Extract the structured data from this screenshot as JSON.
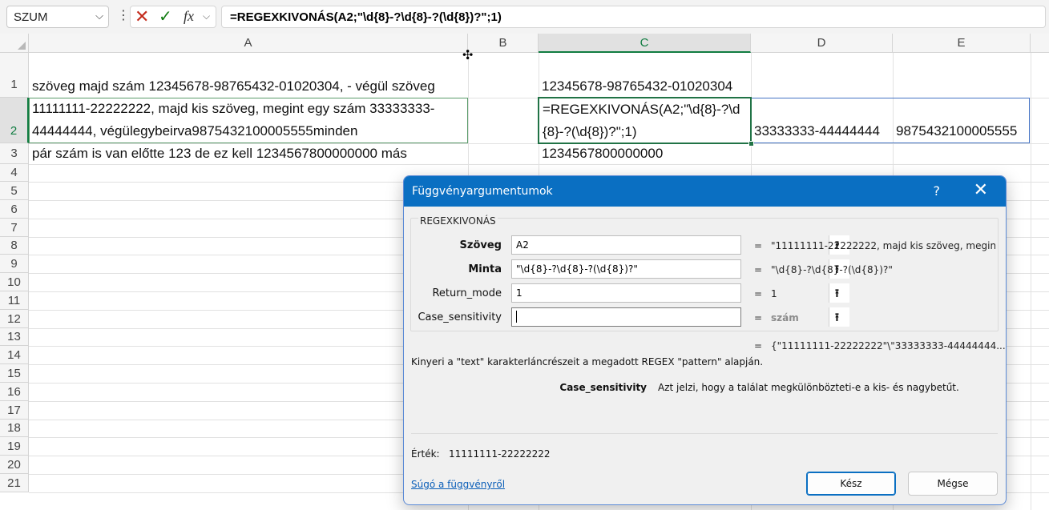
{
  "formula_bar": {
    "name_box": "SZUM",
    "dropdown_glyph": "⌵",
    "more_glyph": "⋮",
    "cancel_glyph": "✕",
    "enter_glyph": "✓",
    "fx_label": "fx",
    "fx_dropdown_glyph": "⌵",
    "formula": "=REGEXKIVONÁS(A2;\"\\d{8}-?\\d{8}-?(\\d{8})?\";1)"
  },
  "grid": {
    "columns": [
      "A",
      "B",
      "C",
      "D",
      "E"
    ],
    "rows": [
      "1",
      "2",
      "3",
      "4",
      "5",
      "6",
      "7",
      "8",
      "9",
      "10",
      "11",
      "12",
      "13",
      "14",
      "15",
      "16",
      "17",
      "18",
      "19",
      "20",
      "21"
    ],
    "cells": {
      "A1": "szöveg majd szám 12345678-98765432-01020304, - végül szöveg",
      "A2": "11111111-22222222, majd kis szöveg, megint egy szám 33333333-44444444, végülegybeirva9875432100005555minden",
      "A3": "pár szám is van előtte 123 de ez kell 1234567800000000 más",
      "C1": "12345678-98765432-01020304",
      "C2": "=REGEXKIVONÁS(A2;\"\\d{8}-?\\d{8}-?(\\d{8})?\";1)",
      "C3": "1234567800000000",
      "D2": "33333333-44444444",
      "E2": "9875432100005555"
    }
  },
  "dialog": {
    "title": "Függvényargumentumok",
    "help_glyph": "?",
    "close_glyph": "✕",
    "function_name": "REGEXKIVONÁS",
    "collapse_glyph": "⭱",
    "equals_glyph": "=",
    "args": [
      {
        "label": "Szöveg",
        "value": "A2",
        "result": "\"11111111-22222222, majd kis szöveg, megint"
      },
      {
        "label": "Minta",
        "value": "\"\\d{8}-?\\d{8}-?(\\d{8})?\"",
        "result": "\"\\d{8}-?\\d{8}-?(\\d{8})?\""
      },
      {
        "label": "Return_mode",
        "value": "1",
        "result": "1"
      },
      {
        "label": "Case_sensitivity",
        "value": "",
        "result": "szám"
      }
    ],
    "formula_result": "{\"11111111-22222222\"\\\"33333333-44444444...",
    "description": "Kinyeri a \"text\" karakterláncrészeit a megadott REGEX \"pattern\" alapján.",
    "param_name": "Case_sensitivity",
    "param_description": "Azt jelzi, hogy a találat megkülönbözteti-e a kis- és nagybetűt.",
    "value_label": "Érték:",
    "value": "11111111-22222222",
    "help_link": "Súgó a függvényről",
    "ok_label": "Kész",
    "cancel_label": "Mégse"
  }
}
